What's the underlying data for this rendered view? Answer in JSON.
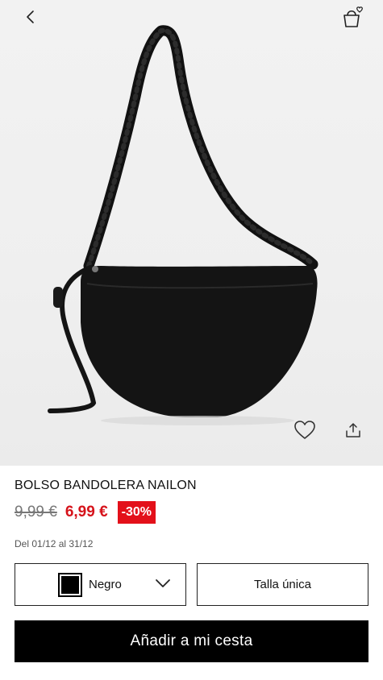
{
  "header": {
    "back_icon": "chevron-left-icon",
    "cart_icon": "shopping-bag-heart-icon"
  },
  "product": {
    "image_alt": "Black nylon crossbody bag",
    "name": "BOLSO BANDOLERA NAILON",
    "price_old": "9,99 €",
    "price_new": "6,99 €",
    "discount": "-30%",
    "promo_dates": "Del 01/12 al 31/12",
    "accent_color": "#e3101a"
  },
  "actions": {
    "favorite_icon": "heart-outline-icon",
    "share_icon": "share-icon"
  },
  "color_select": {
    "label": "Negro",
    "swatch_color": "#000000"
  },
  "size_select": {
    "label": "Talla única"
  },
  "cart_button": {
    "label": "Añadir a mi cesta"
  }
}
